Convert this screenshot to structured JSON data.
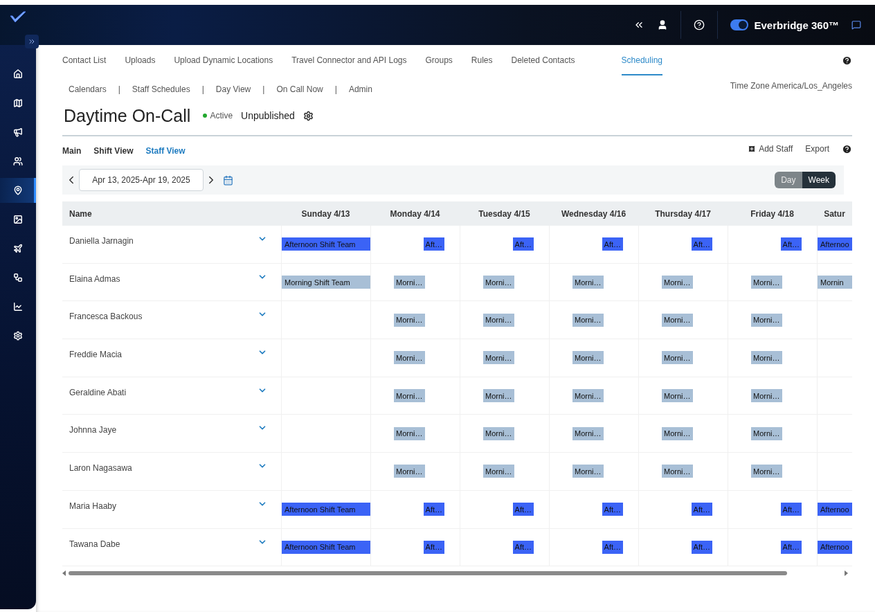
{
  "topbar": {
    "toggle": {
      "on": true
    },
    "product": "Everbridge 360™"
  },
  "sidebar": {
    "items": [
      {
        "selected": false
      },
      {
        "selected": false
      },
      {
        "selected": false
      },
      {
        "selected": false
      },
      {
        "selected": true
      },
      {
        "selected": false
      },
      {
        "selected": false
      },
      {
        "selected": false
      },
      {
        "selected": false
      },
      {
        "selected": false
      }
    ]
  },
  "tabs": [
    {
      "label": "Contact List",
      "selected": false
    },
    {
      "label": "Uploads",
      "selected": false
    },
    {
      "label": "Upload Dynamic Locations",
      "selected": false
    },
    {
      "label": "Travel Connector and API Logs",
      "selected": false
    },
    {
      "label": "Groups",
      "selected": false
    },
    {
      "label": "Rules",
      "selected": false
    },
    {
      "label": "Deleted Contacts",
      "selected": false
    },
    {
      "label": "Scheduling",
      "selected": true
    }
  ],
  "subnav": {
    "separator": "|",
    "items": [
      "Calendars",
      "Staff Schedules",
      "Day View",
      "On Call Now",
      "Admin"
    ]
  },
  "time_zone": "Time Zone America/Los_Angeles",
  "title": "Daytime On-Call",
  "status": {
    "label": "Active",
    "color": "#22a82e"
  },
  "publish_state": "Unpublished",
  "view_tabs": [
    {
      "label": "Main",
      "selected": false
    },
    {
      "label": "Shift View",
      "selected": false
    },
    {
      "label": "Staff View",
      "selected": true
    }
  ],
  "actions": {
    "add": "Add Staff",
    "export": "Export"
  },
  "date_range": "Apr 13, 2025-Apr 19, 2025",
  "range_modes": [
    {
      "label": "Day",
      "selected": false
    },
    {
      "label": "Week",
      "selected": true
    }
  ],
  "table": {
    "name_header": "Name",
    "days": [
      "Sunday 4/13",
      "Monday 4/14",
      "Tuesday 4/15",
      "Wednesday 4/16",
      "Thursday 4/17",
      "Friday 4/18",
      "Satur"
    ],
    "rows": [
      {
        "name": "Daniella Jarnagin",
        "cells": [
          {
            "kind": "full",
            "color": "#3b63f6",
            "label": "Afternoon Shift Team"
          },
          {
            "kind": "late",
            "color": "#3b63f6",
            "label": "Aft…"
          },
          {
            "kind": "late",
            "color": "#3b63f6",
            "label": "Aft…"
          },
          {
            "kind": "late",
            "color": "#3b63f6",
            "label": "Aft…"
          },
          {
            "kind": "late",
            "color": "#3b63f6",
            "label": "Aft…"
          },
          {
            "kind": "late",
            "color": "#3b63f6",
            "label": "Aft…"
          },
          {
            "kind": "full",
            "color": "#3b63f6",
            "label": "Afternoo"
          }
        ]
      },
      {
        "name": "Elaina Admas",
        "cells": [
          {
            "kind": "full",
            "color": "#a8bfd6",
            "label": "Morning Shift Team"
          },
          {
            "kind": "early",
            "color": "#a8bfd6",
            "label": "Morni…"
          },
          {
            "kind": "early",
            "color": "#a8bfd6",
            "label": "Morni…"
          },
          {
            "kind": "early",
            "color": "#a8bfd6",
            "label": "Morni…"
          },
          {
            "kind": "early",
            "color": "#a8bfd6",
            "label": "Morni…"
          },
          {
            "kind": "early",
            "color": "#a8bfd6",
            "label": "Morni…"
          },
          {
            "kind": "full",
            "color": "#a8bfd6",
            "label": "Mornin"
          }
        ]
      },
      {
        "name": "Francesca Backous",
        "cells": [
          {
            "kind": "empty"
          },
          {
            "kind": "early",
            "color": "#a8bfd6",
            "label": "Morni…"
          },
          {
            "kind": "early",
            "color": "#a8bfd6",
            "label": "Morni…"
          },
          {
            "kind": "early",
            "color": "#a8bfd6",
            "label": "Morni…"
          },
          {
            "kind": "early",
            "color": "#a8bfd6",
            "label": "Morni…"
          },
          {
            "kind": "early",
            "color": "#a8bfd6",
            "label": "Morni…"
          },
          {
            "kind": "empty"
          }
        ]
      },
      {
        "name": "Freddie Macia",
        "cells": [
          {
            "kind": "empty"
          },
          {
            "kind": "early",
            "color": "#a8bfd6",
            "label": "Morni…"
          },
          {
            "kind": "early",
            "color": "#a8bfd6",
            "label": "Morni…"
          },
          {
            "kind": "early",
            "color": "#a8bfd6",
            "label": "Morni…"
          },
          {
            "kind": "early",
            "color": "#a8bfd6",
            "label": "Morni…"
          },
          {
            "kind": "early",
            "color": "#a8bfd6",
            "label": "Morni…"
          },
          {
            "kind": "empty"
          }
        ]
      },
      {
        "name": "Geraldine Abati",
        "cells": [
          {
            "kind": "empty"
          },
          {
            "kind": "early",
            "color": "#a8bfd6",
            "label": "Morni…"
          },
          {
            "kind": "early",
            "color": "#a8bfd6",
            "label": "Morni…"
          },
          {
            "kind": "early",
            "color": "#a8bfd6",
            "label": "Morni…"
          },
          {
            "kind": "early",
            "color": "#a8bfd6",
            "label": "Morni…"
          },
          {
            "kind": "early",
            "color": "#a8bfd6",
            "label": "Morni…"
          },
          {
            "kind": "empty"
          }
        ]
      },
      {
        "name": "Johnna Jaye",
        "cells": [
          {
            "kind": "empty"
          },
          {
            "kind": "early",
            "color": "#a8bfd6",
            "label": "Morni…"
          },
          {
            "kind": "early",
            "color": "#a8bfd6",
            "label": "Morni…"
          },
          {
            "kind": "early",
            "color": "#a8bfd6",
            "label": "Morni…"
          },
          {
            "kind": "early",
            "color": "#a8bfd6",
            "label": "Morni…"
          },
          {
            "kind": "early",
            "color": "#a8bfd6",
            "label": "Morni…"
          },
          {
            "kind": "empty"
          }
        ]
      },
      {
        "name": "Laron Nagasawa",
        "cells": [
          {
            "kind": "empty"
          },
          {
            "kind": "early",
            "color": "#a8bfd6",
            "label": "Morni…"
          },
          {
            "kind": "early",
            "color": "#a8bfd6",
            "label": "Morni…"
          },
          {
            "kind": "early",
            "color": "#a8bfd6",
            "label": "Morni…"
          },
          {
            "kind": "early",
            "color": "#a8bfd6",
            "label": "Morni…"
          },
          {
            "kind": "early",
            "color": "#a8bfd6",
            "label": "Morni…"
          },
          {
            "kind": "empty"
          }
        ]
      },
      {
        "name": "Maria Haaby",
        "cells": [
          {
            "kind": "full",
            "color": "#3b63f6",
            "label": "Afternoon Shift Team"
          },
          {
            "kind": "late",
            "color": "#3b63f6",
            "label": "Aft…"
          },
          {
            "kind": "late",
            "color": "#3b63f6",
            "label": "Aft…"
          },
          {
            "kind": "late",
            "color": "#3b63f6",
            "label": "Aft…"
          },
          {
            "kind": "late",
            "color": "#3b63f6",
            "label": "Aft…"
          },
          {
            "kind": "late",
            "color": "#3b63f6",
            "label": "Aft…"
          },
          {
            "kind": "full",
            "color": "#3b63f6",
            "label": "Afternoo"
          }
        ]
      },
      {
        "name": "Tawana Dabe",
        "cells": [
          {
            "kind": "full",
            "color": "#3b63f6",
            "label": "Afternoon Shift Team"
          },
          {
            "kind": "late",
            "color": "#3b63f6",
            "label": "Aft…"
          },
          {
            "kind": "late",
            "color": "#3b63f6",
            "label": "Aft…"
          },
          {
            "kind": "late",
            "color": "#3b63f6",
            "label": "Aft…"
          },
          {
            "kind": "late",
            "color": "#3b63f6",
            "label": "Aft…"
          },
          {
            "kind": "late",
            "color": "#3b63f6",
            "label": "Aft…"
          },
          {
            "kind": "full",
            "color": "#3b63f6",
            "label": "Afternoo"
          }
        ]
      }
    ]
  }
}
